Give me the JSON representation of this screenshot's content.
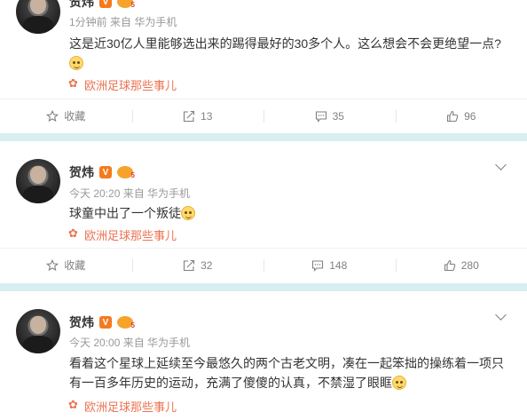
{
  "colors": {
    "topic": "#eb7350",
    "meta": "#999999",
    "action": "#808080",
    "divider": "#d8eef1",
    "vip": "#f47a1f"
  },
  "posts": [
    {
      "author": "贺炜",
      "vip_badge": "V",
      "level_badge": "5",
      "meta": "1分钟前 来自 华为手机",
      "content": "这是近30亿人里能够选出来的踢得最好的30多个人。这么想会不会更绝望一点?",
      "emoji": "doge-emoji",
      "topic": "欧洲足球那些事儿",
      "actions": {
        "favorite": "收藏",
        "repost": "13",
        "comment": "35",
        "like": "96"
      }
    },
    {
      "author": "贺炜",
      "vip_badge": "V",
      "level_badge": "5",
      "meta": "今天 20:20 来自 华为手机",
      "content": "球童中出了一个叛徒",
      "emoji": "doge-emoji",
      "topic": "欧洲足球那些事儿",
      "actions": {
        "favorite": "收藏",
        "repost": "32",
        "comment": "148",
        "like": "280"
      }
    },
    {
      "author": "贺炜",
      "vip_badge": "V",
      "level_badge": "5",
      "meta": "今天 20:00 来自 华为手机",
      "content": "看着这个星球上延续至今最悠久的两个古老文明，凑在一起笨拙的操练着一项只有一百多年历史的运动，充满了傻傻的认真，不禁湿了眼眶",
      "emoji": "doge-emoji",
      "topic": "欧洲足球那些事儿"
    }
  ]
}
